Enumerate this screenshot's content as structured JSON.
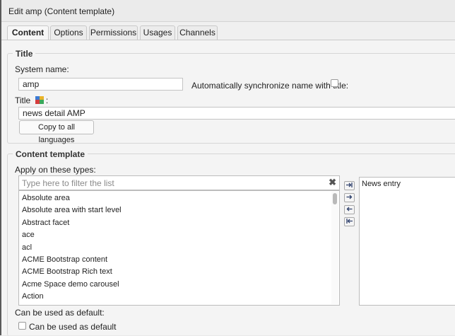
{
  "window": {
    "title": "Edit amp (Content template)"
  },
  "tabs": [
    {
      "label": "Content",
      "active": true
    },
    {
      "label": "Options"
    },
    {
      "label": "Permissions"
    },
    {
      "label": "Usages"
    },
    {
      "label": "Channels"
    }
  ],
  "title_section": {
    "legend": "Title",
    "system_name_label": "System name:",
    "system_name_value": "amp",
    "sync_label": "Automatically synchronize name with title:",
    "title_label": "Title",
    "title_label_suffix": ":",
    "title_value": "news detail AMP",
    "copy_button": "Copy to all languages"
  },
  "content_template": {
    "legend": "Content template",
    "apply_label": "Apply on these types:",
    "filter_placeholder": "Type here to filter the list",
    "filter_clear": "✖",
    "available_types": [
      "Absolute area",
      "Absolute area with start level",
      "Abstract facet",
      "ace",
      "acl",
      "ACME Bootstrap content",
      "ACME Bootstrap Rich text",
      "Acme Space demo carousel",
      "Action"
    ],
    "selected_types": [
      "News entry"
    ],
    "arrow_buttons": [
      "add-all",
      "add",
      "remove",
      "remove-all"
    ],
    "default_section_label": "Can be used as default:",
    "default_checkbox_label": "Can be used as default"
  }
}
